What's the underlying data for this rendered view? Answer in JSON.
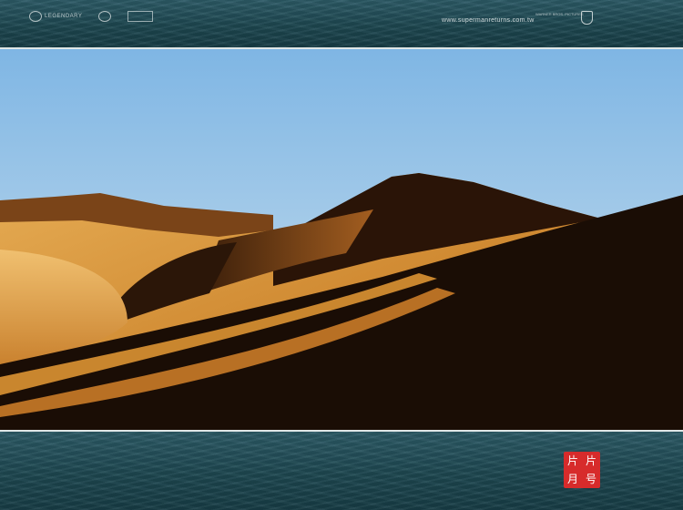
{
  "header": {
    "logos": [
      "LEGENDARY",
      "",
      ""
    ],
    "url": "www.supermanreturns.com.tw",
    "studio_text": "WARNER BROS. PICTURES"
  },
  "photo": {
    "subject": "desert-sand-dunes",
    "sky_color": "#9cc7e8",
    "sand_color": "#d9993f",
    "shadow_color": "#1a0d05"
  },
  "seal": {
    "glyphs": [
      "片",
      "片",
      "月",
      "号"
    ],
    "color": "#d72b2b"
  }
}
